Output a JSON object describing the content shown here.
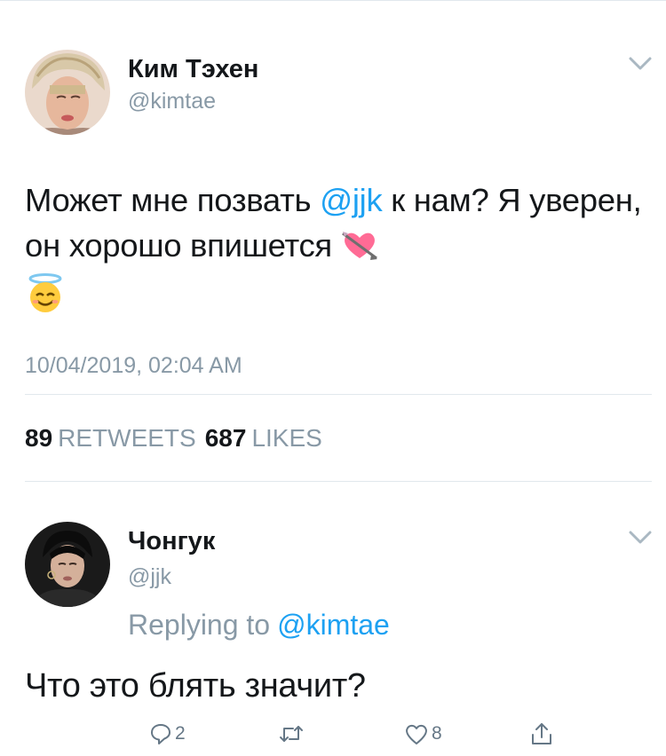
{
  "tweet": {
    "author_name": "Ким Тэхен",
    "author_handle": "@kimtae",
    "text_before": "Может мне позвать ",
    "mention": "@jjk",
    "text_after": " к нам? Я уверен, он хорошо впишется ",
    "emojis": [
      "heart-with-arrow",
      "smiling-face-with-halo"
    ],
    "timestamp": "10/04/2019, 02:04 AM",
    "retweets_count": "89",
    "retweets_label": "RETWEETS",
    "likes_count": "687",
    "likes_label": "LIKES"
  },
  "reply": {
    "author_name": "Чонгук",
    "author_handle": "@jjk",
    "replying_to_label": "Replying to",
    "replying_to_handle": "@kimtae",
    "text": "Что это блять значит?",
    "reply_count": "2",
    "like_count": "8"
  },
  "colors": {
    "accent": "#1da1f2",
    "muted": "#8899a6",
    "divider": "#e1e8ed"
  }
}
